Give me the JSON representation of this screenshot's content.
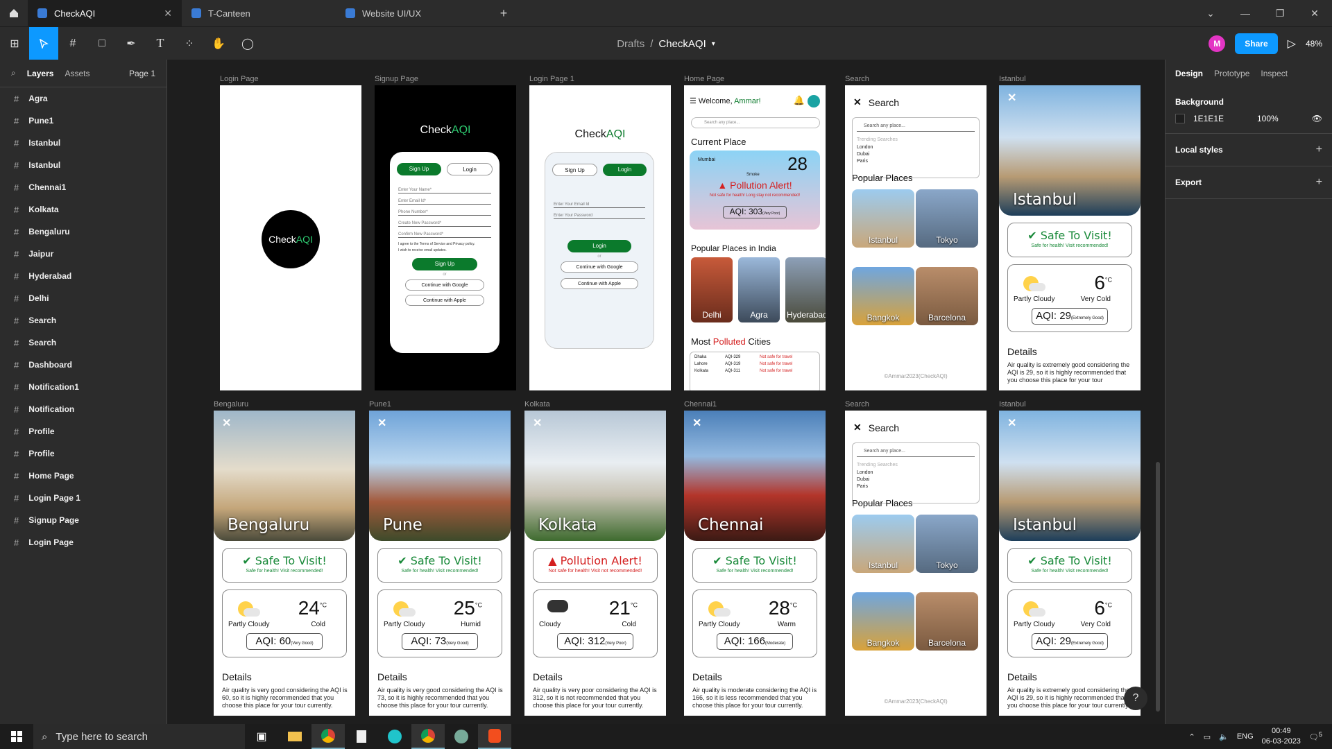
{
  "tabs": [
    {
      "label": "CheckAQI"
    },
    {
      "label": "T-Canteen"
    },
    {
      "label": "Website UI/UX"
    }
  ],
  "toolbar": {
    "drafts": "Drafts",
    "sep": "/",
    "file": "CheckAQI",
    "share": "Share",
    "zoom": "48%",
    "avatar": "M"
  },
  "left_panel": {
    "tab_layers": "Layers",
    "tab_assets": "Assets",
    "page": "Page 1",
    "layers": [
      "Agra",
      "Pune1",
      "Istanbul",
      "Istanbul",
      "Chennai1",
      "Kolkata",
      "Bengaluru",
      "Jaipur",
      "Hyderabad",
      "Delhi",
      "Search",
      "Search",
      "Dashboard",
      "Notification1",
      "Notification",
      "Profile",
      "Profile",
      "Home Page",
      "Login Page 1",
      "Signup Page",
      "Login Page"
    ]
  },
  "right_panel": {
    "tab_design": "Design",
    "tab_prototype": "Prototype",
    "tab_inspect": "Inspect",
    "background": "Background",
    "bg_hex": "1E1E1E",
    "bg_opacity": "100%",
    "local_styles": "Local styles",
    "export": "Export"
  },
  "frames": {
    "login": {
      "label": "Login Page",
      "logo_a": "Check",
      "logo_b": "AQI"
    },
    "signup": {
      "label": "Signup Page",
      "logo_a": "Check",
      "logo_b": "AQI",
      "tab_signup": "Sign Up",
      "tab_login": "Login",
      "f1": "Enter Your Name*",
      "f2": "Enter Email Id*",
      "f3": "Phone Number*",
      "f4": "Create New Password*",
      "f5": "Confirm New Password*",
      "terms": "I agree to the Terms of Service and Privacy policy.",
      "updates": "I wish to receive email updates.",
      "btn": "Sign Up",
      "or": "or",
      "google": "Continue with Google",
      "apple": "Continue with Apple"
    },
    "login1": {
      "label": "Login Page 1",
      "logo_a": "Check",
      "logo_b": "AQI",
      "tab_signup": "Sign Up",
      "tab_login": "Login",
      "f1": "Enter Your Email Id",
      "f2": "Enter Your Password",
      "btn": "Login",
      "or": "or",
      "google": "Continue with Google",
      "apple": "Continue with Apple"
    },
    "home": {
      "label": "Home Page",
      "welcome": "Welcome, ",
      "name": "Ammar!",
      "search": "Search any place...",
      "current": "Current Place",
      "loc": "Mumbai",
      "smoke": "Smoke",
      "temp": "28",
      "alert": "Pollution Alert!",
      "alert_sub": "Not safe for health! Long stay not recommended!",
      "aqi": "AQI: 303",
      "aqi_tag": "(Very Poor)",
      "popular": "Popular Places in India",
      "places": [
        "Delhi",
        "Agra",
        "Hyderabad"
      ],
      "most_a": "Most ",
      "most_b": "Polluted",
      "most_c": " Cities",
      "polluted": [
        {
          "city": "Dhaka",
          "aqi": "AQI-329",
          "note": "Not safe for travel"
        },
        {
          "city": "Lahore",
          "aqi": "AQI-319",
          "note": "Not safe for travel"
        },
        {
          "city": "Kolkata",
          "aqi": "AQI-311",
          "note": "Not safe for travel"
        }
      ]
    },
    "search_top": {
      "label": "Search",
      "title": "Search",
      "placeholder": "Search any place...",
      "trending": "Trending Searches",
      "items": [
        "London",
        "Dubai",
        "Paris"
      ],
      "popular": "Popular Places",
      "places": [
        "Istanbul",
        "Tokyo",
        "Bangkok",
        "Barcelona"
      ],
      "footer": "©Ammar2023(CheckAQI)"
    },
    "search_bottom": {
      "label": "Search",
      "title": "Search",
      "placeholder": "Search any place...",
      "trending": "Trending Searches",
      "items": [
        "London",
        "Dubai",
        "Paris"
      ],
      "popular": "Popular Places",
      "places": [
        "Istanbul",
        "Tokyo",
        "Bangkok",
        "Barcelona"
      ],
      "footer": "©Ammar2023(CheckAQI)"
    },
    "istanbul_top": {
      "label": "Istanbul",
      "city": "Istanbul",
      "status": "Safe To Visit!",
      "status_sub": "Safe for health! Visit recommended!",
      "cond": "Partly Cloudy",
      "temp": "6",
      "unit": "°C",
      "tdesc": "Very Cold",
      "aqi": "AQI: 29",
      "aqi_tag": "(Extremely Good)",
      "details": "Details",
      "text": "Air quality is extremely good considering the AQI is 29, so it is highly recommended that you choose this place for your tour"
    },
    "bengaluru": {
      "label": "Bengaluru",
      "city": "Bengaluru",
      "status": "Safe To Visit!",
      "status_sub": "Safe for health! Visit recommended!",
      "cond": "Partly Cloudy",
      "temp": "24",
      "unit": "°C",
      "tdesc": "Cold",
      "aqi": "AQI: 60",
      "aqi_tag": "(Very Good)",
      "details": "Details",
      "text": "Air quality is very good considering the AQI is 60, so it is highly recommended that you choose this place for your tour currently."
    },
    "pune": {
      "label": "Pune1",
      "city": "Pune",
      "status": "Safe To Visit!",
      "status_sub": "Safe for health! Visit recommended!",
      "cond": "Partly Cloudy",
      "temp": "25",
      "unit": "°C",
      "tdesc": "Humid",
      "aqi": "AQI: 73",
      "aqi_tag": "(Very Good)",
      "details": "Details",
      "text": "Air quality is very good considering the AQI is 73, so it is highly recommended that you choose this place for your tour currently."
    },
    "kolkata": {
      "label": "Kolkata",
      "city": "Kolkata",
      "status": "Pollution Alert!",
      "status_sub": "Not safe for health! Visit not recommended!",
      "cond": "Cloudy",
      "temp": "21",
      "unit": "°C",
      "tdesc": "Cold",
      "aqi": "AQI: 312",
      "aqi_tag": "(Very Poor)",
      "details": "Details",
      "text": "Air quality is very poor considering the AQI is 312, so it is not recommended that you choose this place for your tour currently."
    },
    "chennai": {
      "label": "Chennai1",
      "city": "Chennai",
      "status": "Safe To Visit!",
      "status_sub": "Safe for health! Visit recommended!",
      "cond": "Partly Cloudy",
      "temp": "28",
      "unit": "°C",
      "tdesc": "Warm",
      "aqi": "AQI: 166",
      "aqi_tag": "(Moderate)",
      "details": "Details",
      "text": "Air quality is moderate considering the AQI is 166, so it is less recommended that you choose this place for your tour currently."
    },
    "istanbul_bottom": {
      "label": "Istanbul",
      "city": "Istanbul",
      "status": "Safe To Visit!",
      "status_sub": "Safe for health! Visit recommended!",
      "cond": "Partly Cloudy",
      "temp": "6",
      "unit": "°C",
      "tdesc": "Very Cold",
      "aqi": "AQI: 29",
      "aqi_tag": "(Extremely Good)",
      "details": "Details",
      "text": "Air quality is extremely good considering the AQI is 29, so it is highly recommended that you choose this place for your tour currently."
    }
  },
  "taskbar": {
    "search": "Type here to search",
    "lang": "ENG",
    "time": "00:49",
    "date": "06-03-2023",
    "notif": "5"
  },
  "colors": {
    "accent": "#0d99ff",
    "green": "#0b7a2c",
    "red": "#d42020",
    "teal": "#1aa35a"
  }
}
